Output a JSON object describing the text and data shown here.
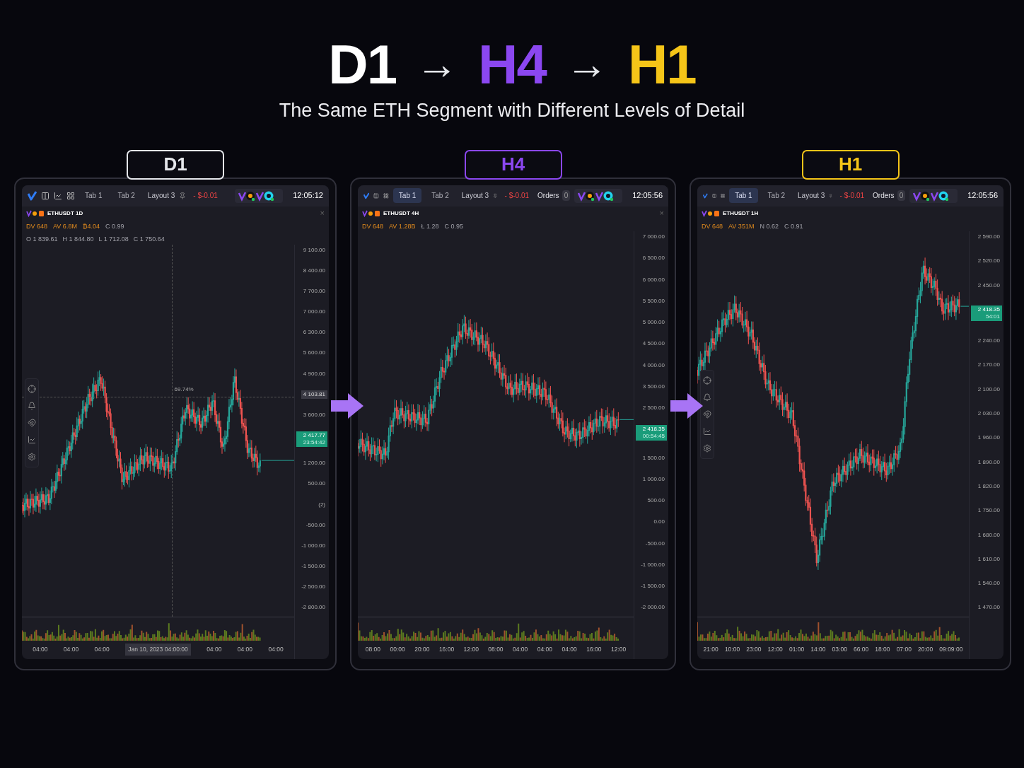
{
  "headline": [
    {
      "text": "D1",
      "color": "#ffffff"
    },
    {
      "text": "→",
      "color": "#e5e7eb"
    },
    {
      "text": "H4",
      "color": "#8b47f0"
    },
    {
      "text": "→",
      "color": "#e5e7eb"
    },
    {
      "text": "H1",
      "color": "#f5c518"
    }
  ],
  "subtitle": "The Same ETH Segment with Different Levels of Detail",
  "panels": [
    {
      "label": "D1",
      "color": "#e5e7eb",
      "side_toolbar": true,
      "tabs": [
        {
          "label": "Tab 1",
          "selected": false
        },
        {
          "label": "Tab 2",
          "selected": false
        }
      ],
      "layout": "Layout 3",
      "pnl": "- $-0.01",
      "time": "12:05:12",
      "symbol": "ETHUSDT 1D",
      "close": "×",
      "stats": [
        {
          "text": "DV 648",
          "kind": "accent"
        },
        {
          "text": "AV 6.8M",
          "kind": "accent"
        },
        {
          "text": "₿4.04",
          "kind": "accent"
        },
        {
          "text": "C 0.99",
          "kind": "plain"
        }
      ],
      "ohlc": [
        "O 1 839.61",
        "H 1 844.80",
        "L 1 712.08",
        "C 1 750.64"
      ],
      "crosshair": {
        "percent": "69.74%"
      },
      "y_axis": [
        {
          "text": "9 100.00",
          "kind": "tick"
        },
        {
          "text": "8 400.00",
          "kind": "tick"
        },
        {
          "text": "7 700.00",
          "kind": "tick"
        },
        {
          "text": "7 000.00",
          "kind": "tick"
        },
        {
          "text": "6 300.00",
          "kind": "tick"
        },
        {
          "text": "5 600.00",
          "kind": "tick"
        },
        {
          "text": "4 900.00",
          "kind": "tick"
        },
        {
          "text": "4 103.81",
          "kind": "crosshair"
        },
        {
          "text": "3 600.00",
          "kind": "tick"
        },
        {
          "text": "2 417.77",
          "countdown": "23:54:42",
          "kind": "price"
        },
        {
          "text": "1 200.00",
          "kind": "tick"
        },
        {
          "text": "500.00",
          "kind": "tick"
        },
        {
          "text": "(2)",
          "kind": "tick"
        },
        {
          "text": "-500.00",
          "kind": "tick"
        },
        {
          "text": "-1 000.00",
          "kind": "tick"
        },
        {
          "text": "-1 500.00",
          "kind": "tick"
        },
        {
          "text": "-2 500.00",
          "kind": "tick"
        },
        {
          "text": "-2 800.00",
          "kind": "tick"
        }
      ],
      "x_axis": [
        {
          "text": "04:00",
          "kind": "tick"
        },
        {
          "text": "04:00",
          "kind": "tick"
        },
        {
          "text": "04:00",
          "kind": "tick"
        },
        {
          "text": "Jan 10, 2023 04:00:00",
          "kind": "crosshair"
        },
        {
          "text": "04:00",
          "kind": "tick"
        },
        {
          "text": "04:00",
          "kind": "tick"
        },
        {
          "text": "04:00",
          "kind": "tick"
        }
      ]
    },
    {
      "label": "H4",
      "color": "#8b47f0",
      "side_toolbar": false,
      "tabs": [
        {
          "label": "Tab 1",
          "selected": true
        },
        {
          "label": "Tab 2",
          "selected": false
        }
      ],
      "layout": "Layout 3",
      "pnl": "- $-0.01",
      "orders": {
        "label": "Orders",
        "count": "0"
      },
      "time": "12:05:56",
      "symbol": "ETHUSDT 4H",
      "close": "×",
      "stats": [
        {
          "text": "DV 648",
          "kind": "accent"
        },
        {
          "text": "AV 1.28B",
          "kind": "accent"
        },
        {
          "text": "Ł 1.28",
          "kind": "plain"
        },
        {
          "text": "C 0.95",
          "kind": "plain"
        }
      ],
      "y_axis": [
        {
          "text": "7 000.00",
          "kind": "tick"
        },
        {
          "text": "6 500.00",
          "kind": "tick"
        },
        {
          "text": "6 000.00",
          "kind": "tick"
        },
        {
          "text": "5 500.00",
          "kind": "tick"
        },
        {
          "text": "5 000.00",
          "kind": "tick"
        },
        {
          "text": "4 500.00",
          "kind": "tick"
        },
        {
          "text": "4 000.00",
          "kind": "tick"
        },
        {
          "text": "3 500.00",
          "kind": "tick"
        },
        {
          "text": "2 500.00",
          "kind": "tick"
        },
        {
          "text": "2 418.35",
          "countdown": "00:54:45",
          "kind": "price"
        },
        {
          "text": "1 500.00",
          "kind": "tick"
        },
        {
          "text": "1 000.00",
          "kind": "tick"
        },
        {
          "text": "500.00",
          "kind": "tick"
        },
        {
          "text": "0.00",
          "kind": "tick"
        },
        {
          "text": "-500.00",
          "kind": "tick"
        },
        {
          "text": "-1 000.00",
          "kind": "tick"
        },
        {
          "text": "-1 500.00",
          "kind": "tick"
        },
        {
          "text": "-2 000.00",
          "kind": "tick"
        }
      ],
      "x_axis": [
        {
          "text": "08:00",
          "kind": "tick"
        },
        {
          "text": "00:00",
          "kind": "tick"
        },
        {
          "text": "20:00",
          "kind": "tick"
        },
        {
          "text": "16:00",
          "kind": "tick"
        },
        {
          "text": "12:00",
          "kind": "tick"
        },
        {
          "text": "08:00",
          "kind": "tick"
        },
        {
          "text": "04:00",
          "kind": "tick"
        },
        {
          "text": "04:00",
          "kind": "tick"
        },
        {
          "text": "04:00",
          "kind": "tick"
        },
        {
          "text": "16:00",
          "kind": "tick"
        },
        {
          "text": "12:00",
          "kind": "tick"
        }
      ]
    },
    {
      "label": "H1",
      "color": "#f5c518",
      "side_toolbar": true,
      "tabs": [
        {
          "label": "Tab 1",
          "selected": true
        },
        {
          "label": "Tab 2",
          "selected": false
        }
      ],
      "layout": "Layout 3",
      "pnl": "- $-0.01",
      "orders": {
        "label": "Orders",
        "count": "0"
      },
      "time": "12:05:56",
      "symbol": "ETHUSDT 1H",
      "stats": [
        {
          "text": "DV 648",
          "kind": "accent"
        },
        {
          "text": "AV 351M",
          "kind": "accent"
        },
        {
          "text": "N 0.62",
          "kind": "plain"
        },
        {
          "text": "C 0.91",
          "kind": "plain"
        }
      ],
      "y_axis": [
        {
          "text": "2 590.00",
          "kind": "tick"
        },
        {
          "text": "2 520.00",
          "kind": "tick"
        },
        {
          "text": "2 450.00",
          "kind": "tick"
        },
        {
          "text": "2 418.35",
          "countdown": "54:01",
          "kind": "price"
        },
        {
          "text": "2 240.00",
          "kind": "tick"
        },
        {
          "text": "2 170.00",
          "kind": "tick"
        },
        {
          "text": "2 100.00",
          "kind": "tick"
        },
        {
          "text": "2 030.00",
          "kind": "tick"
        },
        {
          "text": "1 960.00",
          "kind": "tick"
        },
        {
          "text": "1 890.00",
          "kind": "tick"
        },
        {
          "text": "1 820.00",
          "kind": "tick"
        },
        {
          "text": "1 750.00",
          "kind": "tick"
        },
        {
          "text": "1 680.00",
          "kind": "tick"
        },
        {
          "text": "1 610.00",
          "kind": "tick"
        },
        {
          "text": "1 540.00",
          "kind": "tick"
        },
        {
          "text": "1 470.00",
          "kind": "tick"
        }
      ],
      "x_axis": [
        {
          "text": "21:00",
          "kind": "tick"
        },
        {
          "text": "10:00",
          "kind": "tick"
        },
        {
          "text": "23:00",
          "kind": "tick"
        },
        {
          "text": "12:00",
          "kind": "tick"
        },
        {
          "text": "01:00",
          "kind": "tick"
        },
        {
          "text": "14:00",
          "kind": "tick"
        },
        {
          "text": "03:00",
          "kind": "tick"
        },
        {
          "text": "66:00",
          "kind": "tick"
        },
        {
          "text": "18:00",
          "kind": "tick"
        },
        {
          "text": "07:00",
          "kind": "tick"
        },
        {
          "text": "20:00",
          "kind": "tick"
        },
        {
          "text": "09:09:00",
          "kind": "tick"
        }
      ]
    }
  ]
}
